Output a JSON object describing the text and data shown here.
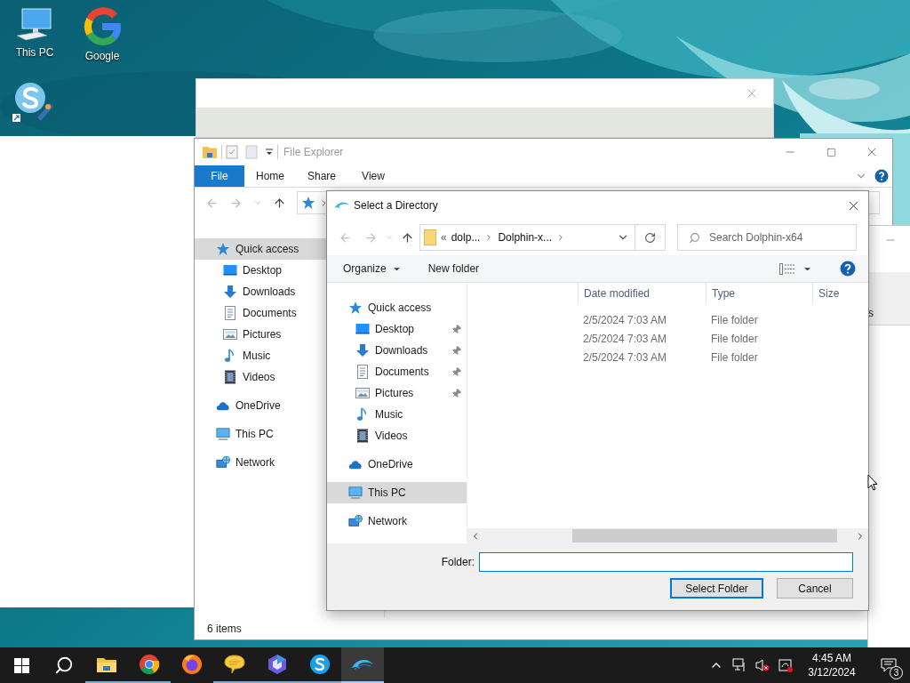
{
  "desktop_icons": [
    {
      "kind": "computer",
      "label": "This PC"
    },
    {
      "kind": "google",
      "label": "Google"
    },
    {
      "kind": "skype"
    }
  ],
  "side_window": {
    "text": "s"
  },
  "explorer": {
    "title": "File Explorer",
    "ribbon_tabs": [
      {
        "label": "File",
        "selected": true
      },
      {
        "label": "Home",
        "selected": false
      },
      {
        "label": "Share",
        "selected": false
      },
      {
        "label": "View",
        "selected": false
      }
    ],
    "nav_items": [
      {
        "kind": "quick-access",
        "label": "Quick access",
        "selected": true,
        "children": [
          {
            "kind": "desktop",
            "label": "Desktop",
            "selected": false
          },
          {
            "kind": "downloads",
            "label": "Downloads",
            "selected": false
          },
          {
            "kind": "documents",
            "label": "Documents",
            "selected": false
          },
          {
            "kind": "pictures",
            "label": "Pictures",
            "selected": false
          },
          {
            "kind": "music",
            "label": "Music",
            "selected": false
          },
          {
            "kind": "videos",
            "label": "Videos",
            "selected": false
          }
        ]
      },
      {
        "kind": "onedrive",
        "label": "OneDrive",
        "selected": false
      },
      {
        "kind": "this-pc",
        "label": "This PC",
        "selected": false
      },
      {
        "kind": "network",
        "label": "Network",
        "selected": false
      }
    ],
    "status": "6 items"
  },
  "dialog": {
    "title": "Select a Directory",
    "overflow_mark": "«",
    "breadcrumb": [
      "dolp...",
      "Dolphin-x..."
    ],
    "search": {
      "placeholder": "Search Dolphin-x64"
    },
    "toolbar": {
      "organize": "Organize",
      "new_folder": "New folder"
    },
    "nav_items": [
      {
        "kind": "quick-access",
        "label": "Quick access",
        "selected": false,
        "children": [
          {
            "kind": "desktop",
            "label": "Desktop",
            "selected": false,
            "pinned": true
          },
          {
            "kind": "downloads",
            "label": "Downloads",
            "selected": false,
            "pinned": true
          },
          {
            "kind": "documents",
            "label": "Documents",
            "selected": false,
            "pinned": true
          },
          {
            "kind": "pictures",
            "label": "Pictures",
            "selected": false,
            "pinned": true
          },
          {
            "kind": "music",
            "label": "Music",
            "selected": false,
            "pinned": false
          },
          {
            "kind": "videos",
            "label": "Videos",
            "selected": false,
            "pinned": false
          }
        ]
      },
      {
        "kind": "onedrive",
        "label": "OneDrive",
        "selected": false
      },
      {
        "kind": "this-pc",
        "label": "This PC",
        "selected": true
      },
      {
        "kind": "network",
        "label": "Network",
        "selected": false
      }
    ],
    "columns": [
      "Date modified",
      "Type",
      "Size"
    ],
    "rows": [
      {
        "date_modified": "2/5/2024 7:03 AM",
        "type": "File folder"
      },
      {
        "date_modified": "2/5/2024 7:03 AM",
        "type": "File folder"
      },
      {
        "date_modified": "2/5/2024 7:03 AM",
        "type": "File folder"
      }
    ],
    "folder_label": "Folder:",
    "buttons": [
      {
        "label": "Select Folder",
        "default": true
      },
      {
        "label": "Cancel",
        "default": false
      }
    ]
  },
  "taskbar": {
    "apps": [
      {
        "kind": "file-explorer",
        "running": true,
        "active": false
      },
      {
        "kind": "chrome",
        "running": true,
        "active": false
      },
      {
        "kind": "firefox",
        "running": false,
        "active": false
      },
      {
        "kind": "chat",
        "running": true,
        "active": false
      },
      {
        "kind": "copilot",
        "running": true,
        "active": false
      },
      {
        "kind": "skype",
        "running": true,
        "active": false
      },
      {
        "kind": "dolphin",
        "running": true,
        "active": true
      }
    ],
    "time": "4:45 AM",
    "date": "3/12/2024",
    "notification_count": "3"
  }
}
